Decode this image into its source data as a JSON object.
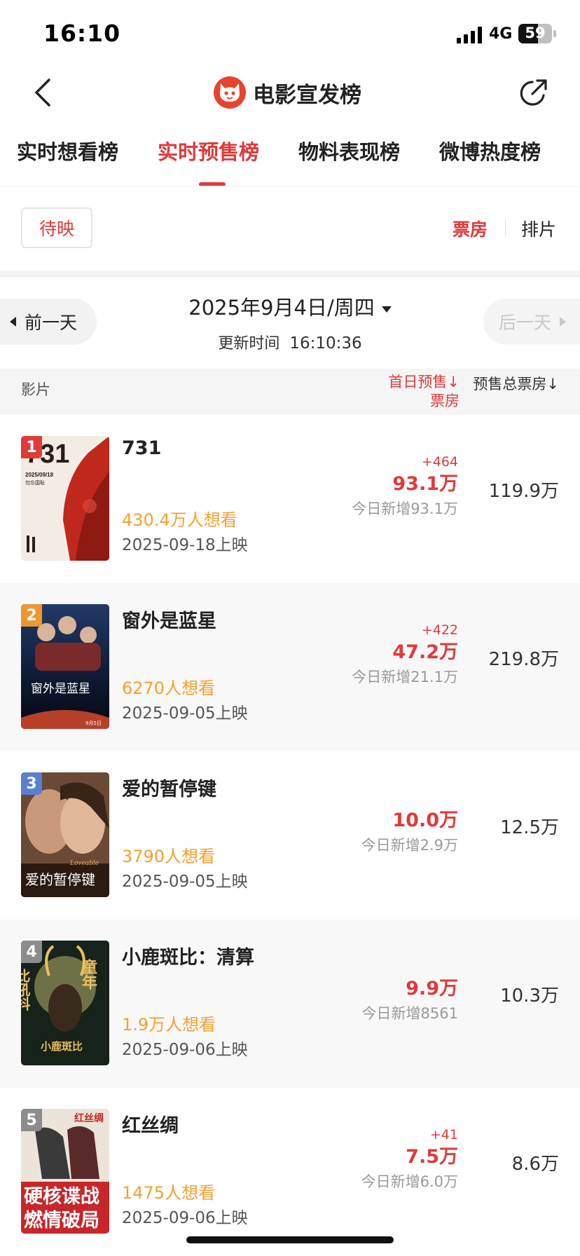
{
  "status_bar": {
    "time": "16:10",
    "network": "4G",
    "battery": "59",
    "battery_level": 0.59
  },
  "nav": {
    "title": "电影宣发榜"
  },
  "tabs": [
    {
      "label": "实时想看榜",
      "active": false
    },
    {
      "label": "实时预售榜",
      "active": true
    },
    {
      "label": "物料表现榜",
      "active": false
    },
    {
      "label": "微博热度榜",
      "active": false
    }
  ],
  "filter": {
    "status_label": "待映",
    "boxoffice_label": "票房",
    "schedule_label": "排片"
  },
  "date_bar": {
    "prev_label": "前一天",
    "next_label": "后一天",
    "date": "2025年9月4日/周四",
    "update_label": "更新时间",
    "update_time": "16:10:36"
  },
  "table_header": {
    "film": "影片",
    "first_day_line1": "首日预售↓",
    "first_day_line2": "票房",
    "total": "预售总票房↓"
  },
  "films": [
    {
      "rank": "1",
      "title": "731",
      "want": "430.4万人想看",
      "release": "2025-09-18上映",
      "delta": "+464",
      "first_day": "93.1万",
      "today": "今日新增93.1万",
      "total": "119.9万",
      "rank_color": "#e03a3a"
    },
    {
      "rank": "2",
      "title": "窗外是蓝星",
      "want": "6270人想看",
      "release": "2025-09-05上映",
      "delta": "+422",
      "first_day": "47.2万",
      "today": "今日新增21.1万",
      "total": "219.8万",
      "rank_color": "#f0962e"
    },
    {
      "rank": "3",
      "title": "爱的暂停键",
      "want": "3790人想看",
      "release": "2025-09-05上映",
      "delta": "",
      "first_day": "10.0万",
      "today": "今日新增2.9万",
      "total": "12.5万",
      "rank_color": "#5b7fd0"
    },
    {
      "rank": "4",
      "title": "小鹿斑比：清算",
      "want": "1.9万人想看",
      "release": "2025-09-06上映",
      "delta": "",
      "first_day": "9.9万",
      "today": "今日新增8561",
      "total": "10.3万",
      "rank_color": "#8c8c8c"
    },
    {
      "rank": "5",
      "title": "红丝绸",
      "want": "1475人想看",
      "release": "2025-09-06上映",
      "delta": "+41",
      "first_day": "7.5万",
      "today": "今日新增6.0万",
      "total": "8.6万",
      "rank_color": "#8c8c8c"
    }
  ],
  "posters": {
    "p1": {
      "title_text": "731",
      "date_text": "2025/09/18",
      "sub_text": "勿忘国耻"
    },
    "p2": {
      "title_text": "窗外是蓝星",
      "date_text": "9月5日"
    },
    "p3": {
      "title_text": "爱的暂停键",
      "en_text": "Loveable"
    },
    "p4": {
      "top_text": "童年",
      "side_text": "比吼抖",
      "title_text": "小鹿斑比"
    },
    "p5": {
      "title_text": "红丝绸",
      "line1": "硬核谍战",
      "line2": "燃情破局"
    }
  }
}
